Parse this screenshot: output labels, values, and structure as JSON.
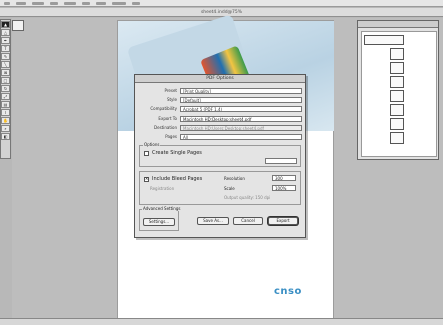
{
  "window": {
    "title": "sheet4.indd@75%"
  },
  "dialog": {
    "title": "PDF Options",
    "rows": [
      {
        "label": "Preset",
        "value": "[Print Quality]"
      },
      {
        "label": "Style",
        "value": "[Default]"
      },
      {
        "label": "Compatibility",
        "value": "Acrobat 5 (PDF 1.4)"
      },
      {
        "label": "Export To",
        "value": "Macintosh HD:Desktop:sheet4.pdf"
      },
      {
        "label": "Destination",
        "value": "Macintosh HD:Users:Desktop:sheet4.pdf"
      },
      {
        "label": "Pages",
        "value": "All"
      }
    ],
    "section_label": "Options",
    "option1": {
      "label": "Create Single Pages",
      "checked": false
    },
    "option1_field": "",
    "option2": {
      "label": "Include Bleed Pages",
      "checked": true
    },
    "option2_sub": "Registration",
    "resolution_label": "Resolution",
    "resolution_value": "300",
    "scale_label": "Scale",
    "scale_value": "100%",
    "note": "Output quality: 150 dpi",
    "advanced_label": "Advanced Settings",
    "buttons": {
      "settings": "Settings...",
      "save": "Save As...",
      "cancel": "Cancel",
      "export": "Export"
    }
  },
  "page": {
    "logo": "cnso"
  },
  "status": {
    "text": ""
  },
  "colors": {
    "accent": "#3a8fc4"
  }
}
